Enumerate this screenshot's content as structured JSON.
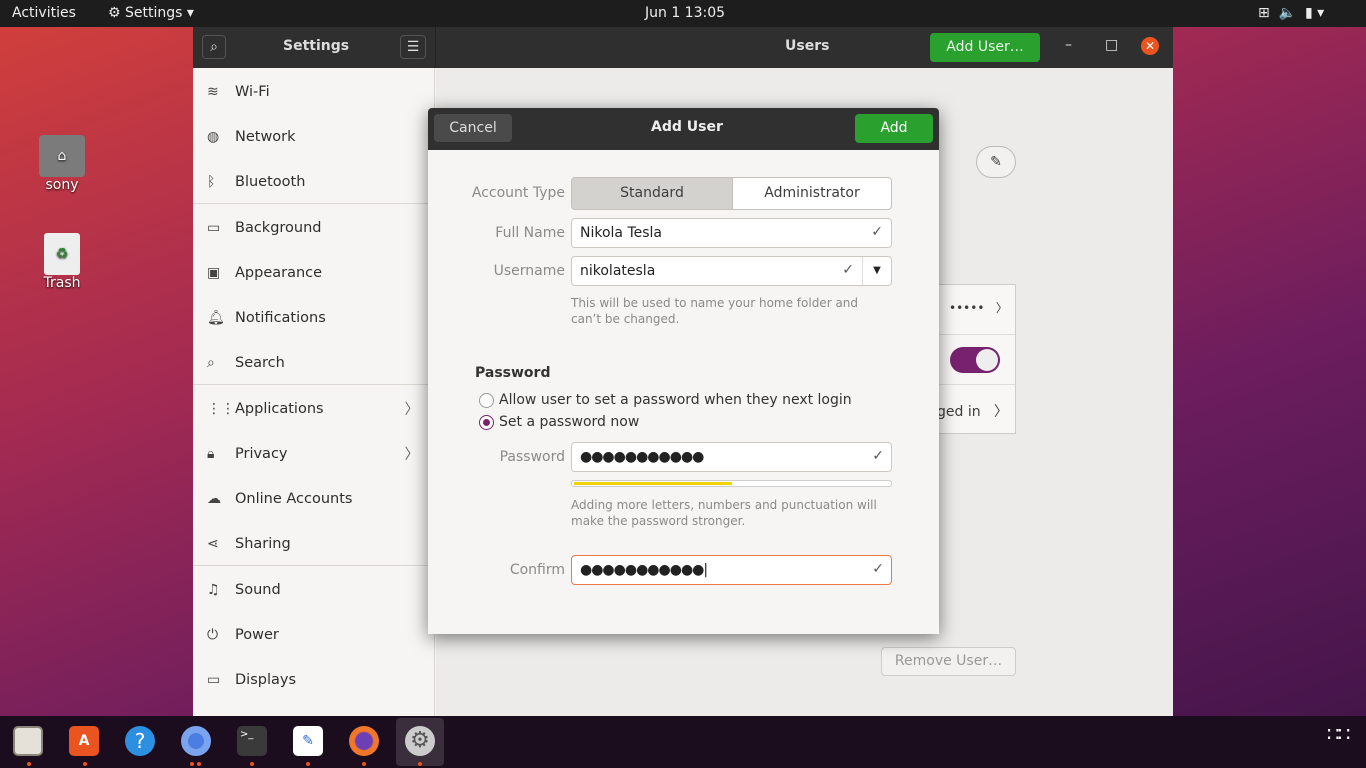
{
  "topbar": {
    "activities": "Activities",
    "app_menu": "Settings",
    "clock": "Jun 1  13:05"
  },
  "desktop": {
    "icons": [
      {
        "label": "sony",
        "icon": "home-folder-icon"
      },
      {
        "label": "Trash",
        "icon": "trash-icon"
      }
    ]
  },
  "window": {
    "sidebar_title": "Settings",
    "title": "Users",
    "add_user": "Add User…"
  },
  "sidebar": {
    "items": [
      {
        "label": "Wi-Fi",
        "icon": "wifi-icon"
      },
      {
        "label": "Network",
        "icon": "network-icon"
      },
      {
        "label": "Bluetooth",
        "icon": "bluetooth-icon"
      },
      {
        "label": "Background",
        "icon": "background-icon"
      },
      {
        "label": "Appearance",
        "icon": "appearance-icon"
      },
      {
        "label": "Notifications",
        "icon": "bell-icon"
      },
      {
        "label": "Search",
        "icon": "search-icon"
      },
      {
        "label": "Applications",
        "icon": "apps-icon"
      },
      {
        "label": "Privacy",
        "icon": "lock-icon"
      },
      {
        "label": "Online Accounts",
        "icon": "cloud-icon"
      },
      {
        "label": "Sharing",
        "icon": "share-icon"
      },
      {
        "label": "Sound",
        "icon": "music-icon"
      },
      {
        "label": "Power",
        "icon": "power-icon"
      },
      {
        "label": "Displays",
        "icon": "display-icon"
      }
    ]
  },
  "background_panel": {
    "password_dots": "•••••",
    "logged_in_fragment": "ged in",
    "remove_user": "Remove User…"
  },
  "dialog": {
    "title": "Add User",
    "cancel": "Cancel",
    "add": "Add",
    "account_type_label": "Account Type",
    "standard": "Standard",
    "administrator": "Administrator",
    "full_name_label": "Full Name",
    "full_name": "Nikola Tesla",
    "username_label": "Username",
    "username": "nikolatesla",
    "username_hint": "This will be used to name your home folder and can’t be changed.",
    "password_heading": "Password",
    "radio_later": "Allow user to set a password when they next login",
    "radio_now": "Set a password now",
    "password_label": "Password",
    "password_value": "●●●●●●●●●●●",
    "strength": 0.5,
    "password_hint": "Adding more letters, numbers and punctuation will make the password stronger.",
    "confirm_label": "Confirm",
    "confirm_value": "●●●●●●●●●●●"
  },
  "dock": [
    "files",
    "software",
    "help",
    "chromium",
    "terminal",
    "text-editor",
    "firefox",
    "settings"
  ],
  "colors": {
    "accent_green": "#2aa12e",
    "focus_orange": "#e9784d",
    "radio_purple": "#77216f"
  }
}
